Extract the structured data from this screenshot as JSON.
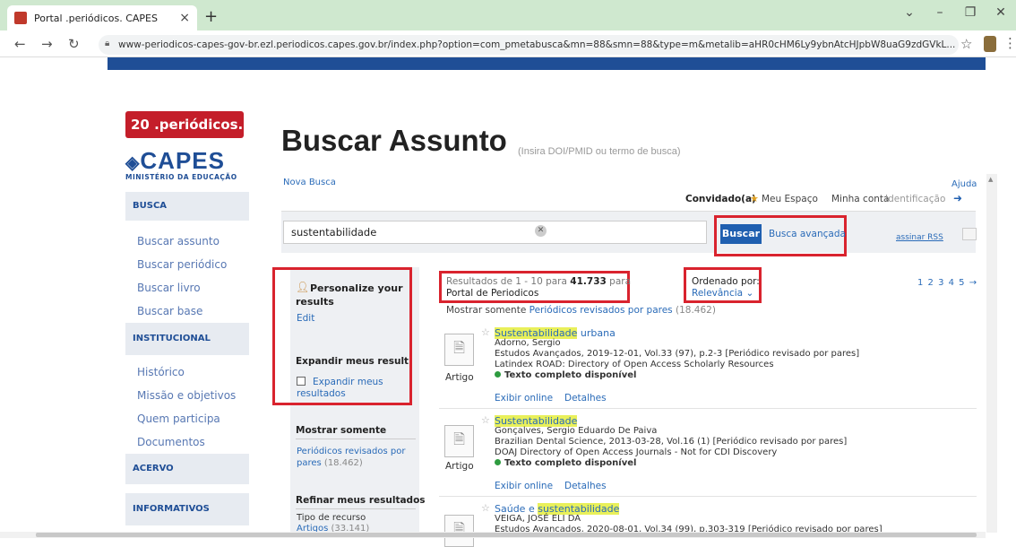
{
  "browser": {
    "tab_title": "Portal .periódicos. CAPES",
    "tab_close": "×",
    "new_tab": "+",
    "url": "www-periodicos-capes-gov-br.ezl.periodicos.capes.gov.br/index.php?option=com_pmetabusca&mn=88&smn=88&type=m&metalib=aHR0cHM6Ly9ybnAtcHJpbW8uaG9zdGVkL..."
  },
  "logo": {
    "badge": "20 .periódicos.",
    "capes": "CAPES",
    "ministry": "MINISTÉRIO DA EDUCAÇÃO"
  },
  "sidebar": {
    "busca": "BUSCA",
    "busca_items": [
      "Buscar assunto",
      "Buscar periódico",
      "Buscar livro",
      "Buscar base"
    ],
    "institucional": "INSTITUCIONAL",
    "inst_items": [
      "Histórico",
      "Missão e objetivos",
      "Quem participa",
      "Documentos"
    ],
    "acervo": "ACERVO",
    "informativos": "INFORMATIVOS"
  },
  "header": {
    "title": "Buscar Assunto",
    "subtitle": "(Insira DOI/PMID ou termo de busca)",
    "nova_busca": "Nova Busca",
    "ajuda": "Ajuda",
    "convidado": "Convidado(a)",
    "meu_espaco": "Meu Espaço",
    "minha_conta": "Minha conta",
    "identificacao": "Identificação"
  },
  "search": {
    "value": "sustentabilidade",
    "buscar": "Buscar",
    "avancada": "Busca avançada",
    "rss": "assinar RSS"
  },
  "personalize": {
    "title": "Personalize your results",
    "edit": "Edit",
    "expandir_title": "Expandir meus resultado",
    "expandir_check": "Expandir meus resultados"
  },
  "filters": {
    "mostrar_title": "Mostrar somente",
    "mostrar_item": "Periódicos revisados por pares",
    "mostrar_count": "(18.462)",
    "refinar_title": "Refinar meus resultados",
    "tipo": "Tipo de recurso",
    "artigos": "Artigos",
    "artigos_count": "(33.141)"
  },
  "results_summary": {
    "prefix": "Resultados de 1 - 10 para",
    "count": "41.733",
    "suffix": "para",
    "portal": "Portal de Periodicos",
    "order_label": "Ordenado por:",
    "order_value": "Relevância",
    "pages": "1 2 3 4 5 →",
    "mostrar": "Mostrar somente",
    "mostrar_link": "Periódicos revisados por pares",
    "mostrar_count": "(18.462)"
  },
  "results": [
    {
      "title_hl": "Sustentabilidade",
      "title_rest": " urbana",
      "author": "Adorno, Sergio",
      "source": "Estudos Avançados, 2019-12-01, Vol.33 (97), p.2-3 [Periódico revisado por pares]",
      "db": "Latindex ROAD: Directory of Open Access Scholarly Resources",
      "type": "Artigo",
      "full": "Texto completo disponível",
      "online": "Exibir online",
      "detalhes": "Detalhes"
    },
    {
      "title_hl": "Sustentabilidade",
      "title_rest": "",
      "author": "Gonçalves, Sergio Eduardo De Paiva",
      "source": "Brazilian Dental Science, 2013-03-28, Vol.16 (1) [Periódico revisado por pares]",
      "db": "DOAJ Directory of Open Access Journals - Not for CDI Discovery",
      "type": "Artigo",
      "full": "Texto completo disponível",
      "online": "Exibir online",
      "detalhes": "Detalhes"
    },
    {
      "title_pre": "Saúde e ",
      "title_hl": "sustentabilidade",
      "author": "VEIGA, JOSÉ ELI DA",
      "source": "Estudos Avançados, 2020-08-01, Vol.34 (99), p.303-319 [Periódico revisado por pares]"
    }
  ]
}
